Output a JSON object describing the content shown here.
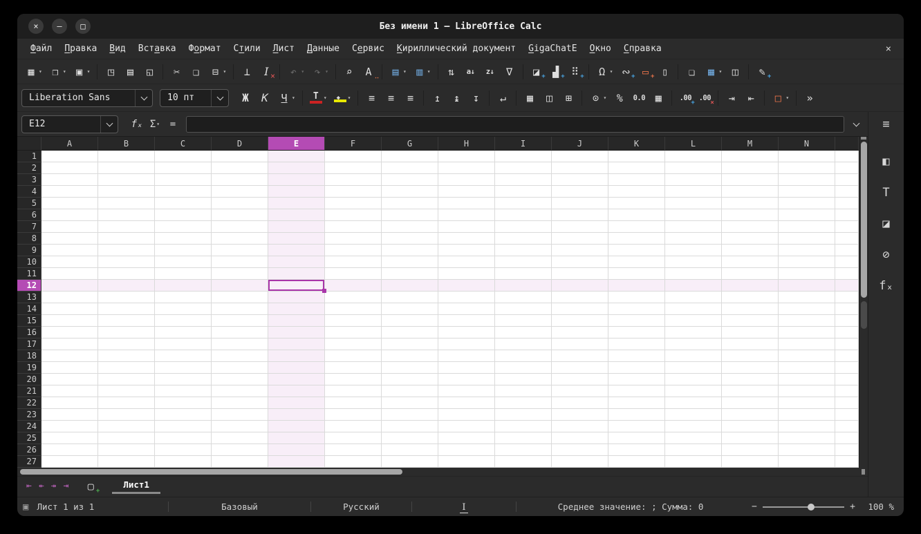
{
  "window": {
    "title": "Без имени 1 — LibreOffice Calc",
    "controls": [
      {
        "name": "close",
        "glyph": "×"
      },
      {
        "name": "minimize",
        "glyph": "–"
      },
      {
        "name": "maximize",
        "glyph": "□"
      }
    ]
  },
  "menu": {
    "items": [
      {
        "label": "Файл",
        "accel": 0
      },
      {
        "label": "Правка",
        "accel": 0
      },
      {
        "label": "Вид",
        "accel": 0
      },
      {
        "label": "Вставка",
        "accel": 3
      },
      {
        "label": "Формат",
        "accel": 1
      },
      {
        "label": "Стили",
        "accel": 1
      },
      {
        "label": "Лист",
        "accel": 0
      },
      {
        "label": "Данные",
        "accel": 0
      },
      {
        "label": "Сервис",
        "accel": 1
      },
      {
        "label": "Кириллический документ",
        "accel": 0
      },
      {
        "label": "GigaChatE",
        "accel": 0
      },
      {
        "label": "Окно",
        "accel": 0
      },
      {
        "label": "Справка",
        "accel": 0
      }
    ],
    "close_glyph": "×"
  },
  "toolbar_standard": [
    {
      "name": "new-document",
      "glyph": "▦",
      "dropdown": true
    },
    {
      "name": "open-file",
      "glyph": "❐",
      "dropdown": true
    },
    {
      "name": "save",
      "glyph": "▣",
      "dropdown": true
    },
    {
      "sep": true
    },
    {
      "name": "export-as-pdf",
      "glyph": "◳"
    },
    {
      "name": "print",
      "glyph": "▤"
    },
    {
      "name": "print-preview",
      "glyph": "◱"
    },
    {
      "sep": true
    },
    {
      "name": "cut",
      "glyph": "✂"
    },
    {
      "name": "copy",
      "glyph": "❑"
    },
    {
      "name": "paste",
      "glyph": "⊟",
      "dropdown": true
    },
    {
      "sep": true
    },
    {
      "name": "clone-formatting",
      "glyph": "⊥"
    },
    {
      "name": "clear-formatting",
      "glyph": "I",
      "cls": "serif-i",
      "accent": "×",
      "accentCls": "acc-red"
    },
    {
      "sep": true
    },
    {
      "name": "undo",
      "glyph": "↶",
      "dropdown": true,
      "disabled": true
    },
    {
      "name": "redo",
      "glyph": "↷",
      "dropdown": true,
      "disabled": true
    },
    {
      "sep": true
    },
    {
      "name": "find-and-replace",
      "glyph": "⌕"
    },
    {
      "name": "spelling",
      "glyph": "A",
      "accent": "‥",
      "accentCls": "acc-spell"
    },
    {
      "sep": true
    },
    {
      "name": "insert-row",
      "glyph": "▤",
      "cls": "tint-blue",
      "dropdown": true
    },
    {
      "name": "insert-column",
      "glyph": "▥",
      "cls": "tint-blue",
      "dropdown": true
    },
    {
      "sep": true
    },
    {
      "name": "sort",
      "glyph": "⇅"
    },
    {
      "name": "sort-ascending",
      "glyph": "a↓",
      "cls": "txt"
    },
    {
      "name": "sort-descending",
      "glyph": "z↓",
      "cls": "txt"
    },
    {
      "name": "autofilter",
      "glyph": "∇"
    },
    {
      "sep": true
    },
    {
      "name": "insert-image",
      "glyph": "◪",
      "accent": "+",
      "accentCls": "acc-blue"
    },
    {
      "name": "insert-chart",
      "glyph": "▟",
      "accent": "+",
      "accentCls": "acc-blue"
    },
    {
      "name": "insert-pivot-table",
      "glyph": "⠿",
      "accent": "+",
      "accentCls": "acc-blue"
    },
    {
      "sep": true
    },
    {
      "name": "insert-special-character",
      "glyph": "Ω",
      "dropdown": true
    },
    {
      "name": "insert-hyperlink",
      "glyph": "∾",
      "accent": "+",
      "accentCls": "acc-blue"
    },
    {
      "name": "insert-comment",
      "glyph": "▭",
      "cls": "tint-orange",
      "accent": "+",
      "accentCls": "acc-orange"
    },
    {
      "name": "insert-text-box",
      "glyph": "▯"
    },
    {
      "sep": true
    },
    {
      "name": "headers-and-footers",
      "glyph": "❏"
    },
    {
      "name": "freeze-rows-and-columns",
      "glyph": "▦",
      "cls": "tint-blue",
      "dropdown": true
    },
    {
      "name": "split-window",
      "glyph": "◫"
    },
    {
      "sep": true
    },
    {
      "name": "show-draw-functions",
      "glyph": "✎",
      "accent": "+",
      "accentCls": "acc-blue"
    }
  ],
  "toolbar_formatting": {
    "font_name": "Liberation Sans",
    "font_size": "10 пт",
    "buttons": [
      {
        "name": "bold",
        "glyph": "Ж",
        "cls": "b"
      },
      {
        "name": "italic",
        "glyph": "К",
        "cls": "i"
      },
      {
        "name": "underline",
        "glyph": "Ч",
        "cls": "u-line",
        "dropdown": true
      },
      {
        "sep": true
      },
      {
        "name": "font-color",
        "glyph": "T",
        "cls": "fc-swatch",
        "dropdown": true
      },
      {
        "name": "highlighting-color",
        "glyph": "",
        "cls": "hl-swatch",
        "dropdown": true
      },
      {
        "sep": true
      },
      {
        "name": "align-left",
        "glyph": "≡"
      },
      {
        "name": "align-center",
        "glyph": "≡"
      },
      {
        "name": "align-right",
        "glyph": "≡"
      },
      {
        "sep": true
      },
      {
        "name": "align-top",
        "glyph": "↥"
      },
      {
        "name": "center-vertically",
        "glyph": "↨"
      },
      {
        "name": "align-bottom",
        "glyph": "↧"
      },
      {
        "sep": true
      },
      {
        "name": "wrap-text",
        "glyph": "↵"
      },
      {
        "sep": true
      },
      {
        "name": "merge-and-center-cells",
        "glyph": "▦"
      },
      {
        "name": "merge-cells",
        "glyph": "◫"
      },
      {
        "name": "unmerge-cells",
        "glyph": "⊞"
      },
      {
        "sep": true
      },
      {
        "name": "format-as-currency",
        "glyph": "⊙",
        "dropdown": true
      },
      {
        "name": "format-as-percent",
        "glyph": "%"
      },
      {
        "name": "format-as-number",
        "glyph": "0.0",
        "cls": "txt"
      },
      {
        "name": "format-as-date",
        "glyph": "▦"
      },
      {
        "sep": true
      },
      {
        "name": "add-decimal-place",
        "glyph": ".00",
        "cls": "txt",
        "accent": "+",
        "accentCls": "acc-blue"
      },
      {
        "name": "delete-decimal-place",
        "glyph": ".00",
        "cls": "txt",
        "accent": "×",
        "accentCls": "acc-red"
      },
      {
        "sep": true
      },
      {
        "name": "increase-indent",
        "glyph": "⇥"
      },
      {
        "name": "decrease-indent",
        "glyph": "⇤"
      },
      {
        "sep": true
      },
      {
        "name": "borders",
        "glyph": "□",
        "cls": "tint-orange",
        "dropdown": true
      },
      {
        "sep": true
      },
      {
        "name": "toolbar-overflow",
        "glyph": "»"
      }
    ]
  },
  "formula_bar": {
    "cell_reference": "E12",
    "formula_value": "",
    "fx_glyph": "fₓ",
    "sum_glyph": "Σ",
    "equals_glyph": "="
  },
  "grid": {
    "columns": [
      "A",
      "B",
      "C",
      "D",
      "E",
      "F",
      "G",
      "H",
      "I",
      "J",
      "K",
      "L",
      "M",
      "N"
    ],
    "row_count": 27,
    "selected_column": "E",
    "selected_row": 12,
    "selected_cell": "E12"
  },
  "sheet_bar": {
    "nav": [
      {
        "name": "first-sheet",
        "glyph": "⇤"
      },
      {
        "name": "previous-sheet",
        "glyph": "↞"
      },
      {
        "name": "next-sheet",
        "glyph": "↠"
      },
      {
        "name": "last-sheet",
        "glyph": "⇥"
      }
    ],
    "add_sheet_glyph": "▢",
    "tabs": [
      {
        "label": "Лист1",
        "active": true
      }
    ]
  },
  "sidebar": {
    "menu_glyph": "≡",
    "icons": [
      {
        "name": "properties",
        "glyph": "◧"
      },
      {
        "name": "styles",
        "glyph": "T"
      },
      {
        "name": "gallery",
        "glyph": "◪"
      },
      {
        "name": "navigator",
        "glyph": "⊘"
      },
      {
        "name": "functions",
        "glyph": "fₓ"
      }
    ]
  },
  "status_bar": {
    "sheet_info": "Лист 1 из 1",
    "page_style": "Базовый",
    "language": "Русский",
    "insert_mode_glyph": "I",
    "selection_stats": "Среднее значение: ; Сумма: 0",
    "zoom_out": "−",
    "zoom_in": "+",
    "zoom_level": "100 %"
  },
  "colors": {
    "selection": "#b44bb4",
    "selection_border": "#a935a9",
    "tint": "#f8eef8",
    "accent_blue": "#4aa8e8",
    "accent_red": "#e05555",
    "accent_green": "#4caf50",
    "accent_orange": "#e8734a"
  }
}
